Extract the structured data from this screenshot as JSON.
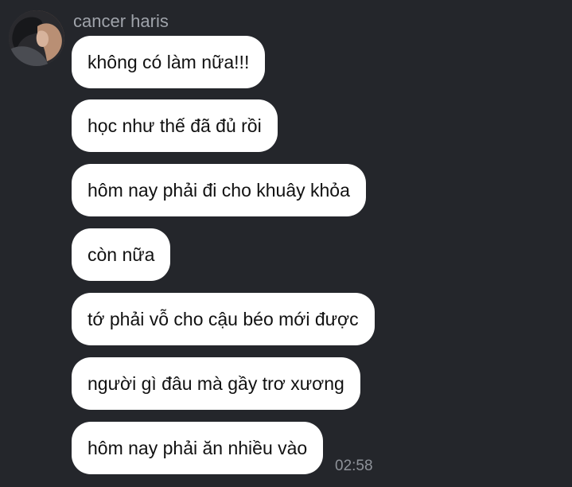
{
  "chat": {
    "sender_name": "cancer haris",
    "avatar_icon": "user-photo-icon",
    "messages": [
      {
        "text": "không có làm nữa!!!"
      },
      {
        "text": "học như thế đã đủ rồi"
      },
      {
        "text": "hôm nay phải đi cho khuây khỏa"
      },
      {
        "text": "còn nữa"
      },
      {
        "text": "tớ phải vỗ cho cậu béo mới được"
      },
      {
        "text": "người gì đâu mà gầy trơ xương"
      },
      {
        "text": "hôm nay phải ăn nhiều vào"
      }
    ],
    "last_time": "02:58"
  },
  "colors": {
    "background": "#24262b",
    "bubble": "#ffffff",
    "sender_text": "#9fa3aa",
    "message_text": "#111111",
    "time_text": "#8e9299"
  }
}
